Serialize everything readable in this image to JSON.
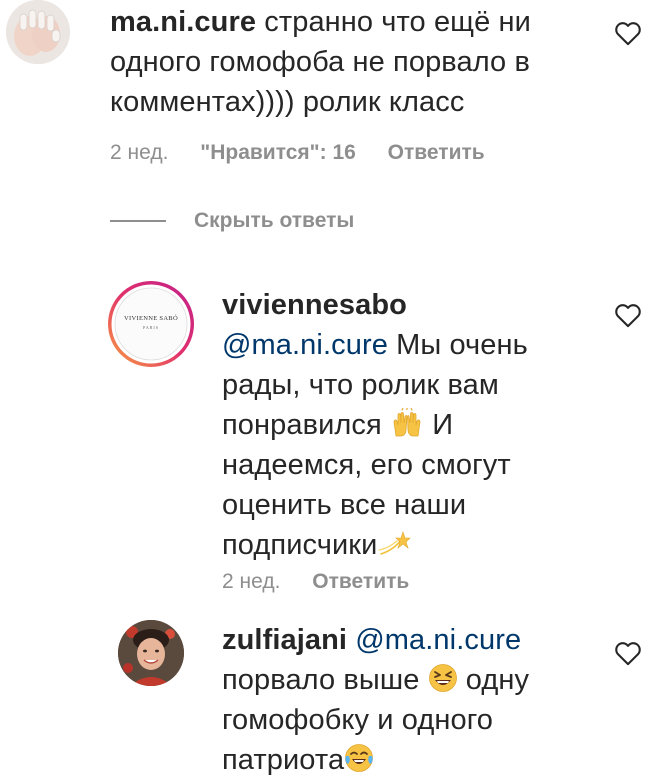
{
  "comments": [
    {
      "username": "ma.ni.cure",
      "text": "странно что ещё ни одного гомофоба не порвало в комментах)))) ролик класс",
      "time": "2 нед.",
      "likes": "\"Нравится\": 16",
      "reply_label": "Ответить"
    },
    {
      "username": "viviennesabo",
      "avatar_text": "VIVIENNE SABÓ",
      "avatar_sub": "PARIS",
      "mention": "@ma.ni.cure",
      "text_part1": "Мы очень рады, что ролик вам понравился",
      "emoji1": "raising-hands",
      "text_part2": "И надеемся, его смогут оценить все наши подписчики",
      "emoji2": "dizzy-star",
      "time": "2 нед.",
      "reply_label": "Ответить"
    },
    {
      "username": "zulfiajani",
      "mention": "@ma.ni.cure",
      "text_part1": "порвало выше",
      "emoji1": "grinning-squinting-face",
      "text_part2": "одну гомофобку и одного патриота",
      "emoji2": "face-with-tears-of-joy"
    }
  ],
  "hide_replies_label": "Скрыть ответы",
  "colors": {
    "text": "#262626",
    "meta": "#8e8e8e",
    "mention": "#00376b",
    "story_ring_start": "#f9a33f",
    "story_ring_end": "#c0218b"
  }
}
